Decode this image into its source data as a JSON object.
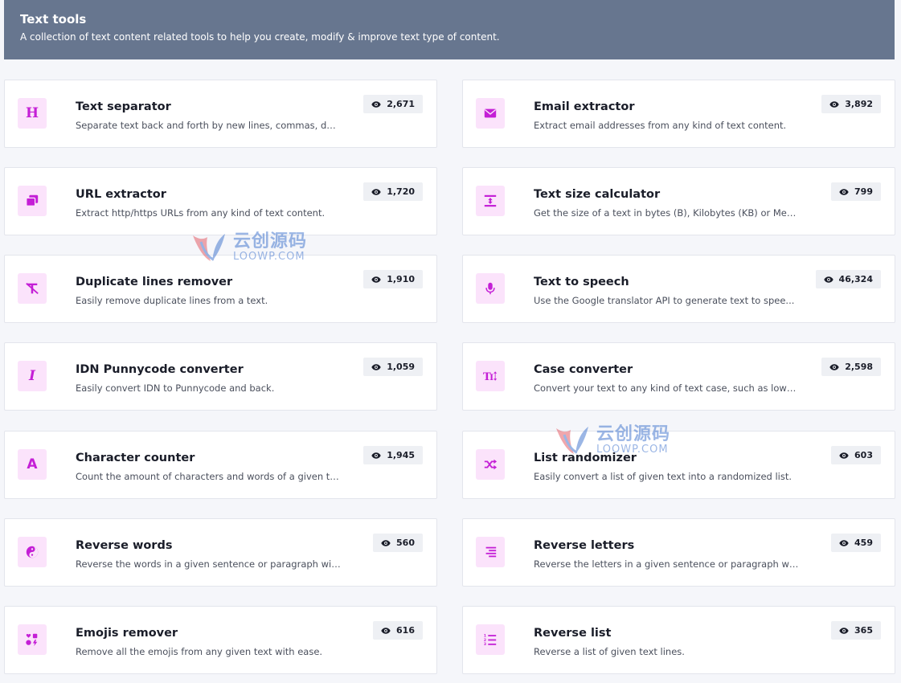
{
  "header": {
    "title": "Text tools",
    "description": "A collection of text content related tools to help you create, modify & improve text type of content."
  },
  "colors": {
    "header_bg": "#67768f",
    "accent": "#c41fd6",
    "icon_bg": "#fbe3fb",
    "badge_bg": "#eef0f4"
  },
  "tools": [
    {
      "title": "Text separator",
      "description": "Separate text back and forth by new lines, commas, dot...",
      "views": "2,671",
      "icon": "heading-icon"
    },
    {
      "title": "Email extractor",
      "description": "Extract email addresses from any kind of text content.",
      "views": "3,892",
      "icon": "envelope-icon"
    },
    {
      "title": "URL extractor",
      "description": "Extract http/https URLs from any kind of text content.",
      "views": "1,720",
      "icon": "window-restore-icon"
    },
    {
      "title": "Text size calculator",
      "description": "Get the size of a text in bytes (B), Kilobytes (KB) or Megab...",
      "views": "799",
      "icon": "text-height-icon"
    },
    {
      "title": "Duplicate lines remover",
      "description": "Easily remove duplicate lines from a text.",
      "views": "1,910",
      "icon": "remove-format-icon"
    },
    {
      "title": "Text to speech",
      "description": "Use the Google translator API to generate text to spee...",
      "views": "46,324",
      "icon": "microphone-icon"
    },
    {
      "title": "IDN Punnycode converter",
      "description": "Easily convert IDN to Punnycode and back.",
      "views": "1,059",
      "icon": "italic-icon"
    },
    {
      "title": "Case converter",
      "description": "Convert your text to any kind of text case, such as lower...",
      "views": "2,598",
      "icon": "text-case-icon"
    },
    {
      "title": "Character counter",
      "description": "Count the amount of characters and words of a given te...",
      "views": "1,945",
      "icon": "font-icon"
    },
    {
      "title": "List randomizer",
      "description": "Easily convert a list of given text into a randomized list.",
      "views": "603",
      "icon": "shuffle-icon"
    },
    {
      "title": "Reverse words",
      "description": "Reverse the words in a given sentence or paragraph with ...",
      "views": "560",
      "icon": "yin-yang-icon"
    },
    {
      "title": "Reverse letters",
      "description": "Reverse the letters in a given sentence or paragraph with ...",
      "views": "459",
      "icon": "align-right-icon"
    },
    {
      "title": "Emojis remover",
      "description": "Remove all the emojis from any given text with ease.",
      "views": "616",
      "icon": "icons-icon"
    },
    {
      "title": "Reverse list",
      "description": "Reverse a list of given text lines.",
      "views": "365",
      "icon": "list-ol-icon"
    }
  ],
  "watermark": {
    "cn": "云创源码",
    "en": "LOOWP.COM"
  }
}
